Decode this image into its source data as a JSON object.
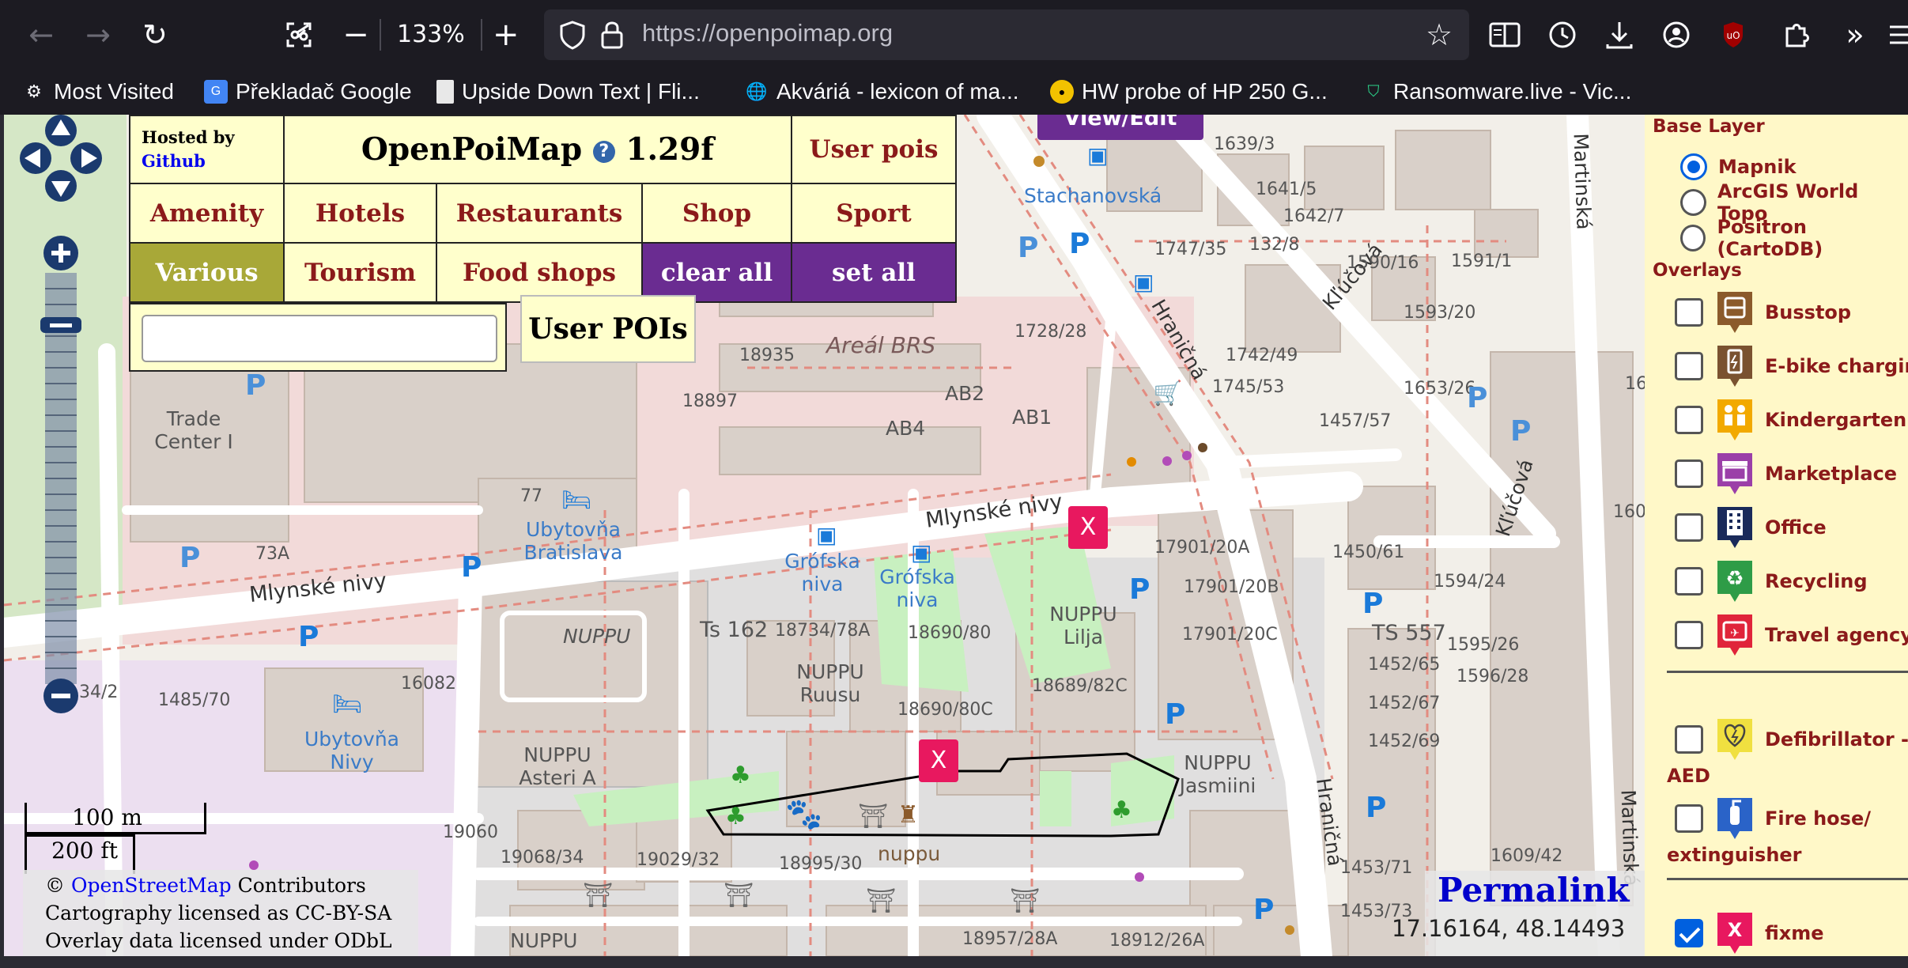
{
  "browser": {
    "zoom": "133%",
    "url": "https://openpoimap.org",
    "bookmarks": [
      {
        "label": "Most Visited",
        "icon": "gear-icon"
      },
      {
        "label": "Překladač Google",
        "icon": "google-translate-icon"
      },
      {
        "label": "Upside Down Text | Fli...",
        "icon": "document-icon"
      },
      {
        "label": "Akváriá - lexicon of ma...",
        "icon": "globe-icon"
      },
      {
        "label": "HW probe of HP 250 G...",
        "icon": "penguin-icon"
      },
      {
        "label": "Ransomware.live - Vic...",
        "icon": "shield-icon"
      }
    ]
  },
  "panel": {
    "hosted_by": "Hosted by",
    "github": "Github",
    "title": "OpenPoiMap",
    "help": "?",
    "version": "1.29f",
    "user_pois": "User pois",
    "categories": [
      "Amenity",
      "Hotels",
      "Restaurants",
      "Shop",
      "Sport",
      "Various",
      "Tourism",
      "Food shops"
    ],
    "clear_all": "clear all",
    "set_all": "set all",
    "search_value": "",
    "user_pois_button": "User POIs",
    "view_edit": "View/Edit"
  },
  "map": {
    "labels": [
      "Mlynské nivy",
      "Mlynské nivy",
      "Stachanovská",
      "Hraničná",
      "Hraničná",
      "Kľúčová",
      "Kľúčová",
      "Martinská",
      "Martinská",
      "Areál BRS",
      "Trade Center I",
      "Ubytovňa Bratislava",
      "Ubytovňa Nivy",
      "Grófska niva",
      "Grófska niva",
      "NUPPU Lilja",
      "NUPPU Ruusu",
      "NUPPU Asteri A",
      "NUPPU Jasmiini",
      "NUPPU",
      "nuppu",
      "Ts 162",
      "TS 557",
      "AB2",
      "AB4",
      "AB1",
      "73A",
      "77",
      "18935",
      "18897",
      "1728/28",
      "1639/3",
      "1641/5",
      "1642/7",
      "132/8",
      "1747/35",
      "1590/16",
      "1591/1",
      "1593/20",
      "1742/49",
      "1745/53",
      "1653/26",
      "1457/57",
      "17901/20A",
      "17901/20B",
      "17901/20C",
      "1450/61",
      "1594/24",
      "1595/26",
      "1596/28",
      "1452/65",
      "1452/67",
      "1452/69",
      "18734/78A",
      "18690/80",
      "18690/80C",
      "18689/82C",
      "16082",
      "1485/70",
      "34/2",
      "19060",
      "19068/34",
      "19029/32",
      "18995/30",
      "18957/28A",
      "18912/26A",
      "1453/71",
      "1453/73",
      "1609/42",
      "160",
      "16"
    ],
    "scale_m": "100 m",
    "scale_ft": "200 ft",
    "attribution_prefix": "©",
    "attribution_link": "OpenStreetMap",
    "attribution_suffix": "Contributors",
    "cartography": "Cartography licensed as CC-BY-SA",
    "overlay": "Overlay data licensed under ODbL",
    "permalink": "Permalink",
    "coords": "17.16164, 48.14493",
    "fixme_marker": "X"
  },
  "layers": {
    "base_heading": "Base Layer",
    "base": [
      {
        "label": "Mapnik",
        "selected": true
      },
      {
        "label": "ArcGIS World Topo",
        "selected": false
      },
      {
        "label": "Positron (CartoDB)",
        "selected": false
      }
    ],
    "overlays_heading": "Overlays",
    "overlays": [
      {
        "label": "Busstop",
        "checked": false,
        "color": "#8b5a2b",
        "icon": "bus-icon"
      },
      {
        "label": "E-bike charging",
        "checked": false,
        "color": "#7a5230",
        "icon": "ebike-icon"
      },
      {
        "label": "Kindergarten",
        "checked": false,
        "color": "#f2a900",
        "icon": "kindergarten-icon"
      },
      {
        "label": "Marketplace",
        "checked": false,
        "color": "#9b3fa8",
        "icon": "marketplace-icon"
      },
      {
        "label": "Office",
        "checked": false,
        "color": "#1a2a5a",
        "icon": "office-icon"
      },
      {
        "label": "Recycling",
        "checked": false,
        "color": "#2e9c47",
        "icon": "recycling-icon"
      },
      {
        "label": "Travel agency",
        "checked": false,
        "color": "#e0243a",
        "icon": "travel-agency-icon"
      }
    ],
    "defib_label_1": "Defibrillator -",
    "defib_label_2": "AED",
    "firehose_label_1": "Fire hose/",
    "firehose_label_2": "extinguisher",
    "fixme_label": "fixme",
    "fixme_checked": true
  }
}
